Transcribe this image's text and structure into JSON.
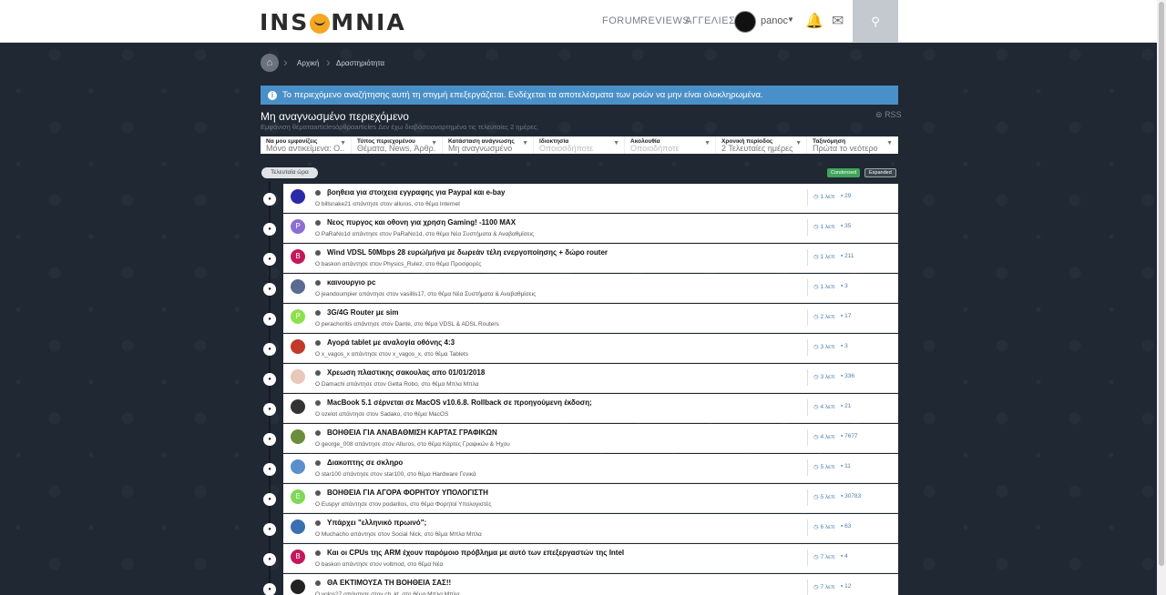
{
  "header": {
    "logo": "INSOMNIA",
    "nav": [
      "FORUM",
      "REVIEWS",
      "ΑΓΓΕΛΙΕΣ"
    ],
    "username": "panoc"
  },
  "breadcrumb": [
    "Αρχική",
    "Δραστηριότητα"
  ],
  "notice": "Το περιεχόμενο αναζήτησης αυτή τη στιγμή επεξεργάζεται. Ενδέχεται τα αποτελέσματα των ροών να μην είναι ολοκληρωμένα.",
  "page": {
    "title": "Μη αναγνωσμένο περιεχόμενο",
    "subtitle": "Εμφάνιση θέματαarticlesάρθραarticles Δεν έχω διαβάσειαναρτημένα τις τελευταίες 2 ημέρες.",
    "rss": "RSS"
  },
  "filters": [
    {
      "label": "Να μου εμφανίζεις",
      "value": "Μόνο αντικείμενα: Ο..."
    },
    {
      "label": "Τύπος περιεχομένου",
      "value": "Θέματα, News, Άρθρ..."
    },
    {
      "label": "Κατάσταση ανάγνωσης",
      "value": "Μη αναγνωσμένο"
    },
    {
      "label": "Ιδιοκτησία",
      "value": "Οποιοσδήποτε",
      "placeholder": true
    },
    {
      "label": "Ακολουθία",
      "value": "Οποιοδήποτε",
      "placeholder": true
    },
    {
      "label": "Χρονική περίοδος",
      "value": "2 Τελευταίες ημέρες"
    },
    {
      "label": "Ταξινόμηση",
      "value": "Πρώτα το νεότερο"
    }
  ],
  "time_group": "Τελευταία ώρα",
  "view_toggles": {
    "condensed": "Condensed",
    "expanded": "Expanded"
  },
  "colors": {
    "accent": "#4a90c8",
    "condensed": "#3fa55a"
  },
  "items": [
    {
      "title": "βοηθεια για στοιχεια εγγραφης για Paypal και e-bay",
      "meta": "Ο billsnake21 απάντησε στον alluros, στο θέμα Internet",
      "time": "1 λεπ",
      "replies": "29",
      "avatar": "",
      "avatar_color": "#2a2aa8"
    },
    {
      "title": "Νεος πυργος και οθονη για χρηση Gaming! -1100 ΜΑΧ",
      "meta": "Ο PaRaNo1d απάντησε στον PaRaNo1d, στο θέμα Νέα Συστήματα & Αναβαθμίσεις",
      "time": "1 λεπ",
      "replies": "35",
      "avatar": "P",
      "avatar_color": "#8a6fd0"
    },
    {
      "title": "Wind VDSL 50Mbps 28 ευρώ/μήνα με δωρεάν τέλη ενεργοποίησης + δώρο router",
      "meta": "Ο baskon απάντησε στον Physics_Rulez, στο θέμα Προσφορές",
      "time": "1 λεπ",
      "replies": "211",
      "avatar": "B",
      "avatar_color": "#c2185b"
    },
    {
      "title": "καινουργιο pc",
      "meta": "Ο jeandoumpier απάντησε στον vasillis17, στο θέμα Νέα Συστήματα & Αναβαθμίσεις",
      "time": "1 λεπ",
      "replies": "3",
      "avatar": "",
      "avatar_color": "#5a6a90"
    },
    {
      "title": "3G/4G Router με sim",
      "meta": "Ο perachoritis απάντησε στον Dante, στο θέμα VDSL & ADSL Routers",
      "time": "2 λεπ",
      "replies": "17",
      "avatar": "P",
      "avatar_color": "#8ee04a"
    },
    {
      "title": "Αγορά tablet με αναλογία οθόνης 4:3",
      "meta": "Ο x_vagos_x απάντησε στον x_vagos_x, στο θέμα Tablets",
      "time": "3 λεπ",
      "replies": "3",
      "avatar": "",
      "avatar_color": "#c0392b"
    },
    {
      "title": "Χρεωση πλαστικης σακουλας απο 01/01/2018",
      "meta": "Ο Damachi απάντησε στον Getta Robo, στο θέμα Μπλα Μπλα",
      "time": "3 λεπ",
      "replies": "336",
      "avatar": "",
      "avatar_color": "#e8c8b8"
    },
    {
      "title": "MacBook 5.1 σέρνεται σε MacOS v10.6.8. Rollback σε προηγούμενη έκδοση;",
      "meta": "Ο ozelot απάντησε στον Sadako, στο θέμα MacOS",
      "time": "4 λεπ",
      "replies": "21",
      "avatar": "",
      "avatar_color": "#333333"
    },
    {
      "title": "ΒΟΗΘΕΙΑ ΓΙΑ ΑΝΑΒΑΘΜΙΣΗ ΚΑΡΤΑΣ ΓΡΑΦΙΚΩΝ",
      "meta": "Ο george_008 απάντησε στον Alluros, στο θέμα Κάρτες Γραφικών & Ήχου",
      "time": "4 λεπ",
      "replies": "7677",
      "avatar": "",
      "avatar_color": "#6a8f3a"
    },
    {
      "title": "Διακοπτης σε σκληρο",
      "meta": "Ο star100 απάντησε στον star100, στο θέμα Hardware Γενικά",
      "time": "5 λεπ",
      "replies": "11",
      "avatar": "",
      "avatar_color": "#5b8fc9"
    },
    {
      "title": "ΒΟΗΘΕΙΑ ΓΙΑ ΑΓΟΡΑ ΦΟΡΗΤΟΥ ΥΠΟΛΟΓΙΣΤΗ",
      "meta": "Ο Euspyr απάντησε στον podarilos, στο θέμα Φορητοί Υπολογιστές",
      "time": "5 λεπ",
      "replies": "30783",
      "avatar": "E",
      "avatar_color": "#7ed957"
    },
    {
      "title": "Υπάρχει \"ελληνικό πρωινό\";",
      "meta": "Ο Muchacho απάντησε στον Social Nick, στο θέμα Μπλα Μπλα",
      "time": "6 λεπ",
      "replies": "63",
      "avatar": "",
      "avatar_color": "#3a6fb0"
    },
    {
      "title": "Και οι CPUs της ARM έχουν παρόμοιο πρόβλημα με αυτό των επεξεργαστών της Intel",
      "meta": "Ο baskon απάντησε στον voltmod, στο θέμα Νέα",
      "time": "7 λεπ",
      "replies": "4",
      "avatar": "B",
      "avatar_color": "#c2185b"
    },
    {
      "title": "ΘΑ ΕΚΤΙΜΟΥΣΑ ΤΗ ΒΟΗΘΕΙΑ ΣΑΣ!!",
      "meta": "Ο volos27 απάντησε στον ch_kt, στο θέμα Μπλα Μπλα",
      "time": "7 λεπ",
      "replies": "12",
      "avatar": "",
      "avatar_color": "#222222"
    }
  ]
}
